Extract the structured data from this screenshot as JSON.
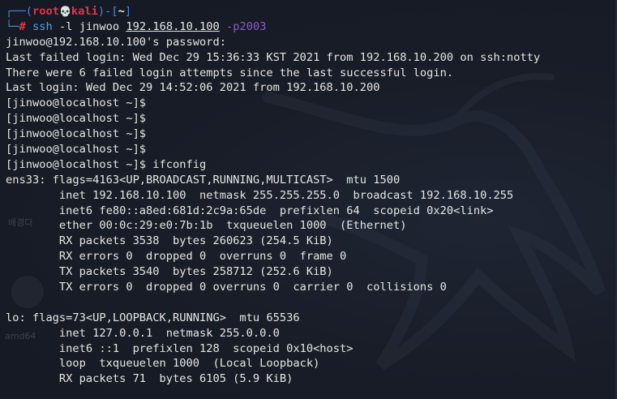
{
  "prompt": {
    "user": "root",
    "skull": "💀",
    "host": "kali",
    "cwd": "~",
    "command_name": "ssh",
    "command_flag": "-l",
    "command_user": "jinwoo",
    "command_host": "192.168.10.100",
    "command_port_option": "-p2003"
  },
  "output_lines": [
    "jinwoo@192.168.10.100's password:",
    "Last failed login: Wed Dec 29 15:36:33 KST 2021 from 192.168.10.200 on ssh:notty",
    "There were 6 failed login attempts since the last successful login.",
    "Last login: Wed Dec 29 14:52:06 2021 from 192.168.10.200",
    "[jinwoo@localhost ~]$",
    "[jinwoo@localhost ~]$",
    "[jinwoo@localhost ~]$",
    "[jinwoo@localhost ~]$",
    "[jinwoo@localhost ~]$ ifconfig",
    "ens33: flags=4163<UP,BROADCAST,RUNNING,MULTICAST>  mtu 1500",
    "        inet 192.168.10.100  netmask 255.255.255.0  broadcast 192.168.10.255",
    "        inet6 fe80::a8ed:681d:2c9a:65de  prefixlen 64  scopeid 0x20<link>",
    "        ether 00:0c:29:e0:7b:1b  txqueuelen 1000  (Ethernet)",
    "        RX packets 3538  bytes 260623 (254.5 KiB)",
    "        RX errors 0  dropped 0  overruns 0  frame 0",
    "        TX packets 3540  bytes 258712 (252.6 KiB)",
    "        TX errors 0  dropped 0 overruns 0  carrier 0  collisions 0",
    "",
    "lo: flags=73<UP,LOOPBACK,RUNNING>  mtu 65536",
    "        inet 127.0.0.1  netmask 255.0.0.0",
    "        inet6 ::1  prefixlen 128  scopeid 0x10<host>",
    "        loop  txqueuelen 1000  (Local Loopback)",
    "        RX packets 71  bytes 6105 (5.9 KiB)"
  ],
  "background": {
    "label_1": "배경다",
    "label_2": "amd64"
  },
  "colors": {
    "background": "#191d28",
    "text": "#e6e6e6",
    "prompt_box": "#4d86e0",
    "prompt_user": "#e8334a",
    "command": "#4ea6e8",
    "option": "#8a5cc6"
  }
}
